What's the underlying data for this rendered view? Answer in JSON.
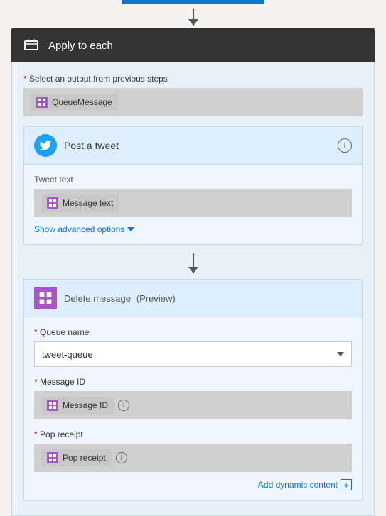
{
  "top_bar": {
    "visible": true
  },
  "apply_to_each": {
    "label": "Apply to each",
    "icon": "loop-icon"
  },
  "select_output": {
    "label": "Select an output from previous steps",
    "token": "QueueMessage"
  },
  "post_tweet": {
    "title": "Post a tweet",
    "tweet_text_label": "Tweet text",
    "tweet_token": "Message text",
    "show_advanced": "Show advanced options",
    "info_label": "i"
  },
  "delete_message": {
    "title": "Delete message",
    "preview_label": "(Preview)",
    "queue_name_label": "Queue name",
    "queue_name_value": "tweet-queue",
    "message_id_label": "Message ID",
    "message_id_token": "Message ID",
    "pop_receipt_label": "Pop receipt",
    "pop_receipt_token": "Pop receipt",
    "add_dynamic_label": "Add dynamic content",
    "info_label": "i"
  },
  "icons": {
    "loop": "↻",
    "info": "i",
    "chevron_down": "▾",
    "plus": "+",
    "storage": "▦"
  },
  "colors": {
    "accent_blue": "#0078d4",
    "twitter_blue": "#1da1f2",
    "purple": "#a855c8",
    "card_bg": "#ddeeff",
    "body_bg": "#f0f6ff",
    "token_bg": "#c8c8c8",
    "dark_header": "#333333"
  }
}
